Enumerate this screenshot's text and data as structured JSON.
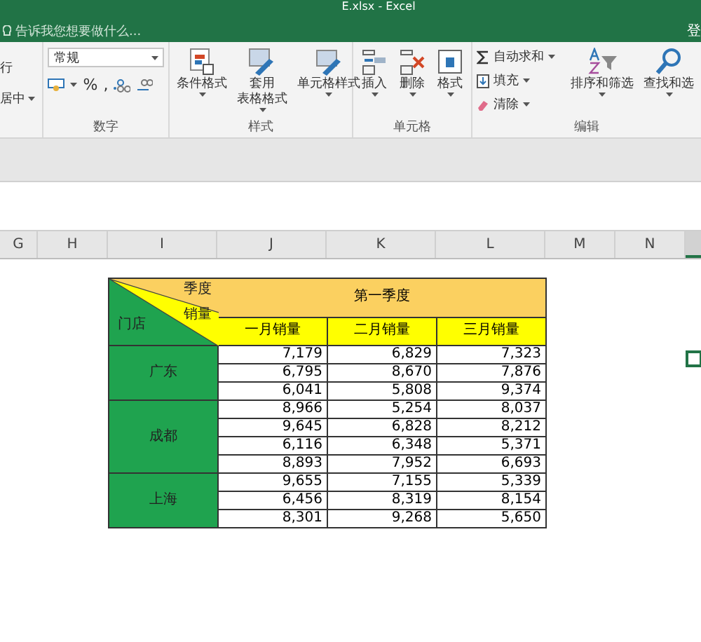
{
  "window": {
    "title": "E.xlsx - Excel",
    "sign_in": "登"
  },
  "tell_me": {
    "placeholder": "告诉我您想要做什么..."
  },
  "ribbon": [
    {
      "items": [
        {
          "kind": "text",
          "label": "行"
        },
        {
          "kind": "text",
          "label": "居中",
          "caret": true
        }
      ]
    },
    {
      "label": "数字",
      "items": [
        {
          "kind": "select",
          "value": "常规"
        },
        {
          "kind": "numfmt",
          "percent": "%",
          "comma": ","
        }
      ]
    },
    {
      "label": "样式",
      "items": [
        {
          "kind": "large",
          "lines": [
            "条件格式"
          ],
          "caret": true
        },
        {
          "kind": "large",
          "lines": [
            "套用",
            "表格格式"
          ],
          "caret": true
        },
        {
          "kind": "large",
          "lines": [
            "单元格样式"
          ],
          "caret": true
        }
      ]
    },
    {
      "label": "单元格",
      "items": [
        {
          "kind": "large",
          "lines": [
            "插入"
          ],
          "caret": true
        },
        {
          "kind": "large",
          "lines": [
            "删除"
          ],
          "caret": true
        },
        {
          "kind": "large",
          "lines": [
            "格式"
          ],
          "caret": true
        }
      ]
    },
    {
      "label": "编辑",
      "items": [
        {
          "kind": "stack",
          "entries": [
            {
              "label": "自动求和",
              "caret": true
            },
            {
              "label": "填充",
              "caret": true
            },
            {
              "label": "清除",
              "caret": true
            }
          ]
        },
        {
          "kind": "large",
          "lines": [
            "排序和筛选"
          ],
          "caret": true
        },
        {
          "kind": "large",
          "lines": [
            "查找和选"
          ],
          "caret": true
        }
      ]
    }
  ],
  "columns": [
    "G",
    "H",
    "I",
    "J",
    "K",
    "L",
    "M",
    "N"
  ],
  "table": {
    "corner": {
      "top": "季度",
      "middle": "销量",
      "bottom": "门店"
    },
    "quarter": "第一季度",
    "months": [
      "一月销量",
      "二月销量",
      "三月销量"
    ],
    "stores": [
      {
        "name": "广东",
        "rows": [
          [
            "7,179",
            "6,829",
            "7,323"
          ],
          [
            "6,795",
            "8,670",
            "7,876"
          ],
          [
            "6,041",
            "5,808",
            "9,374"
          ]
        ]
      },
      {
        "name": "成都",
        "rows": [
          [
            "8,966",
            "5,254",
            "8,037"
          ],
          [
            "9,645",
            "6,828",
            "8,212"
          ],
          [
            "6,116",
            "6,348",
            "5,371"
          ],
          [
            "8,893",
            "7,952",
            "6,693"
          ]
        ]
      },
      {
        "name": "上海",
        "rows": [
          [
            "9,655",
            "7,155",
            "5,339"
          ],
          [
            "6,456",
            "8,319",
            "8,154"
          ],
          [
            "8,301",
            "9,268",
            "5,650"
          ]
        ]
      }
    ]
  }
}
